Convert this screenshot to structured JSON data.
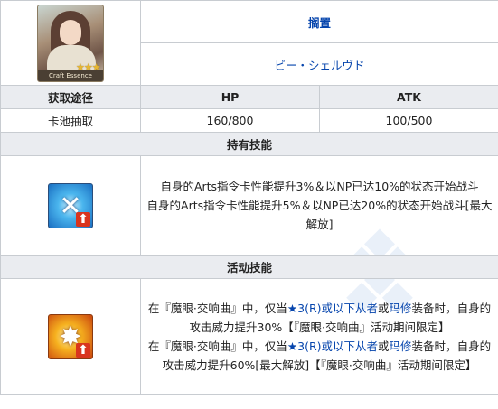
{
  "card": {
    "name": "搁置",
    "illustrator": "ビー・シェルヴド",
    "frame_label": "Craft Essence",
    "rarity_stars": "★★★"
  },
  "stats": {
    "source_header": "获取途径",
    "hp_header": "HP",
    "atk_header": "ATK",
    "source": "卡池抽取",
    "hp": "160/800",
    "atk": "100/500"
  },
  "passive": {
    "header": "持有技能",
    "icon": "arts-up-icon",
    "line1": "自身的Arts指令卡性能提升3%＆以NP已达10%的状态开始战斗",
    "line2": "自身的Arts指令卡性能提升5%＆以NP已达20%的状态开始战斗[最大解放]"
  },
  "event": {
    "header": "活动技能",
    "icon": "attack-up-icon",
    "l1_pre": "在『魔眼·交响曲』中，仅当",
    "l1_link1": "★3(R)或以下从者",
    "l1_mid": "或",
    "l1_link2": "玛修",
    "l1_post": "装备时，",
    "l1_rest": "自身的攻击威力提升30%【『魔眼·交响曲』活动期间限定】",
    "l2_pre": "在『魔眼·交响曲』中，仅当",
    "l2_link1": "★3(R)或以下从者",
    "l2_mid": "或",
    "l2_link2": "玛修",
    "l2_post": "装备时，",
    "l2_rest": "自身的攻击威力提升60%[最大解放]【『魔眼·交响曲』活动期间限定】"
  },
  "colors": {
    "header_bg": "#eaecf0",
    "border": "#c8ccd1",
    "link": "#0645ad"
  }
}
